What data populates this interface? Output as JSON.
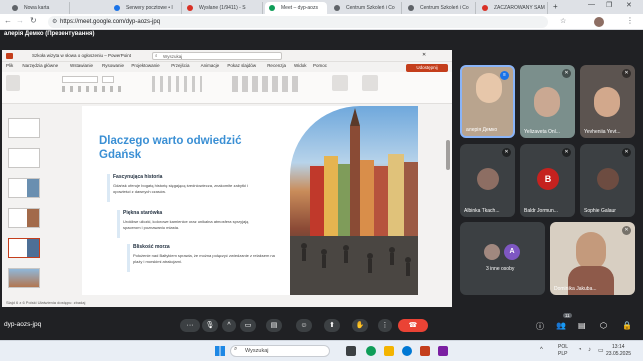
{
  "browser": {
    "tabs": [
      {
        "label": "Nowa karta",
        "color": "#5f6368"
      },
      {
        "label": "Serwery pocztowe • I",
        "color": "#1a73e8"
      },
      {
        "label": "Wysłane (1/9411) - S",
        "color": "#d93025"
      },
      {
        "label": "Meet – dyp-aozs",
        "color": "#0f9d58"
      },
      {
        "label": "Centrum Szkoleń i Co",
        "color": "#5f6368"
      },
      {
        "label": "Centrum Szkoleń i Co",
        "color": "#5f6368"
      },
      {
        "label": "ZACZAROWANY SAM",
        "color": "#d93025"
      }
    ],
    "url": "https://meet.google.com/dyp-aozs-jpq"
  },
  "meet": {
    "presenter_label": "алерія Демко (Презентування)",
    "meeting_code": "dyp-aozs-jpq",
    "participants_count": "11",
    "participants": [
      {
        "name": "алерія Демко"
      },
      {
        "name": "Yelizaveta Onl..."
      },
      {
        "name": "Yevheniia Yevt..."
      },
      {
        "name": "Albinka Tkach..."
      },
      {
        "name": "Baldr Jormun...",
        "initial": "B"
      },
      {
        "name": "Sophie Galaur"
      },
      {
        "name": "3 inne osoby",
        "initial": "A"
      },
      {
        "name": "Dominika Jakuba..."
      }
    ]
  },
  "ppt": {
    "title": "Szkoła wizyta w słowa o ogłoszeniu – PowerPoint",
    "search_placeholder": "Wyszukaj",
    "share_label": "Udostępnij",
    "ribbon_tabs": [
      "Plik",
      "Narzędzia główne",
      "Wstawianie",
      "Rysowanie",
      "Projektowanie",
      "Przejścia",
      "Animacje",
      "Pokaz slajdów",
      "Recenzja",
      "Widok",
      "Pomoc"
    ],
    "status": "Slajd 6 z 6   Polski   Ułatwienia dostępu: zbadaj"
  },
  "slide": {
    "title": "Dlaczego warto odwiedzić Gdańsk",
    "sections": [
      {
        "heading": "Fascynująca historia",
        "text": "Gdańsk oferuje bogatą historię sięgającą średniowiecza, znakomite zabytki i opowieści z dawnych czasów."
      },
      {
        "heading": "Piękna starówka",
        "text": "Urokliwe uliczki, kolorowe kamienice oraz unikalna atmosfera sprzyjają spacerom i poznawaniu miasta."
      },
      {
        "heading": "Bliskość morza",
        "text": "Położenie nad Bałtykiem sprawia, że można połączyć zwiedzanie z relaksem na plaży i morskimi atrakcjami."
      }
    ]
  },
  "taskbar": {
    "search_placeholder": "Wyszukaj",
    "lang": "POL",
    "lang2": "PLP",
    "time": "13:14",
    "date": "23.05.2025"
  }
}
